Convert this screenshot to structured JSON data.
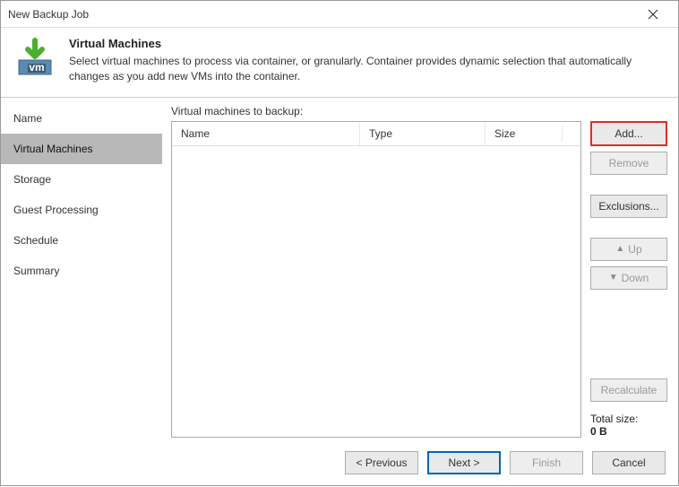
{
  "window": {
    "title": "New Backup Job"
  },
  "header": {
    "heading": "Virtual Machines",
    "description": "Select virtual machines to process via container, or granularly. Container provides dynamic selection that automatically changes as you add new VMs into the container."
  },
  "sidebar": {
    "items": [
      {
        "label": "Name",
        "active": false
      },
      {
        "label": "Virtual Machines",
        "active": true
      },
      {
        "label": "Storage",
        "active": false
      },
      {
        "label": "Guest Processing",
        "active": false
      },
      {
        "label": "Schedule",
        "active": false
      },
      {
        "label": "Summary",
        "active": false
      }
    ]
  },
  "main": {
    "label": "Virtual machines to backup:",
    "columns": {
      "name": "Name",
      "type": "Type",
      "size": "Size"
    },
    "buttons": {
      "add": "Add...",
      "remove": "Remove",
      "exclusions": "Exclusions...",
      "up": "Up",
      "down": "Down",
      "recalculate": "Recalculate"
    },
    "total_label": "Total size:",
    "total_value": "0 B"
  },
  "footer": {
    "previous": "< Previous",
    "next": "Next >",
    "finish": "Finish",
    "cancel": "Cancel"
  }
}
